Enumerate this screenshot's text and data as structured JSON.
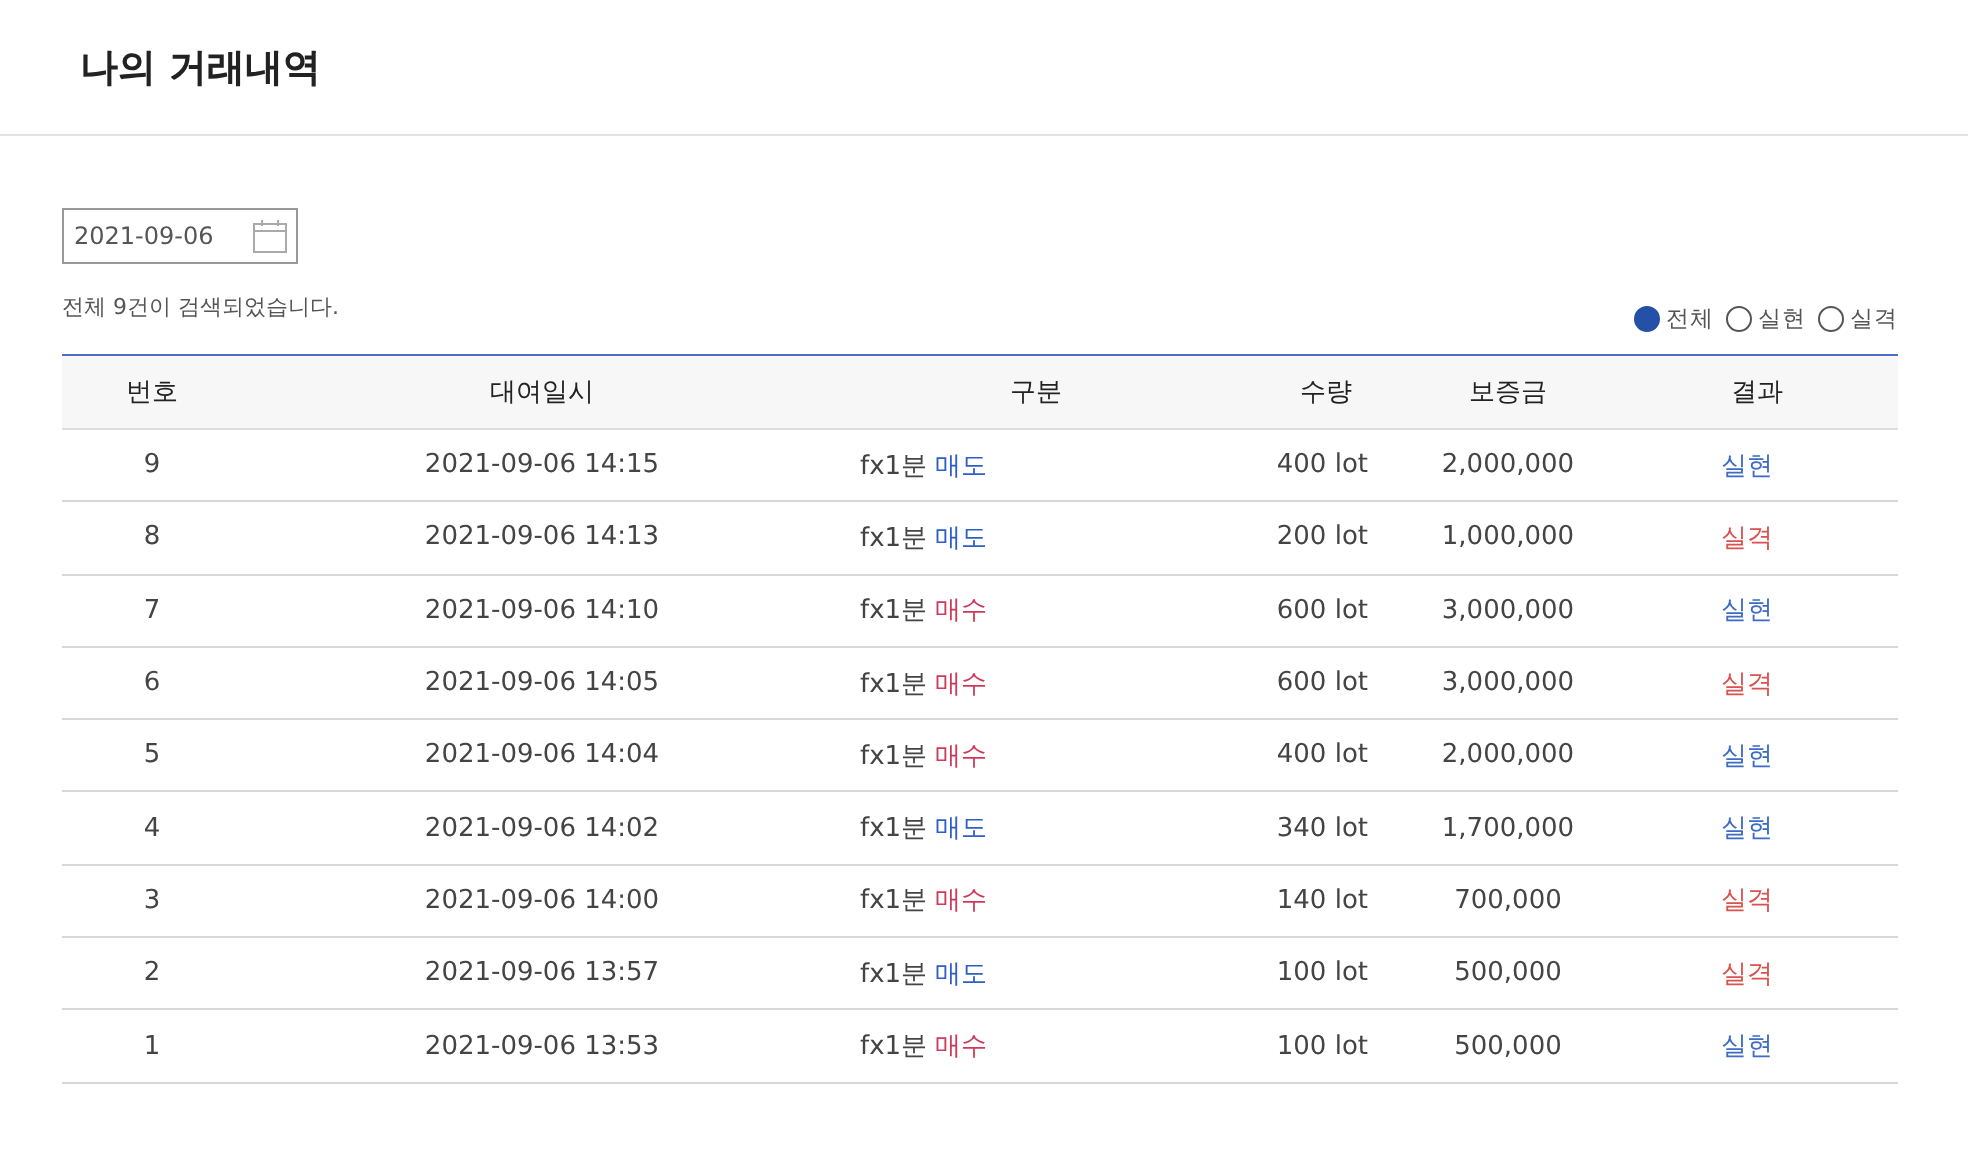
{
  "page": {
    "title": "나의 거래내역"
  },
  "date_field": {
    "value": "2021-09-06"
  },
  "result_count": "전체 9건이 검색되었습니다.",
  "filters": [
    {
      "label": "전체",
      "selected": true
    },
    {
      "label": "실현",
      "selected": false
    },
    {
      "label": "실격",
      "selected": false
    }
  ],
  "table": {
    "columns": [
      "번호",
      "대여일시",
      "구분",
      "수량",
      "보증금",
      "결과"
    ],
    "rows": [
      {
        "no": "9",
        "datetime": "2021-09-06 14:15",
        "product": "fx1분",
        "side": {
          "text": "매도",
          "kind": "sell"
        },
        "quantity": "400 lot",
        "deposit": "2,000,000",
        "result": {
          "text": "실현",
          "kind": "win"
        }
      },
      {
        "no": "8",
        "datetime": "2021-09-06 14:13",
        "product": "fx1분",
        "side": {
          "text": "매도",
          "kind": "sell"
        },
        "quantity": "200 lot",
        "deposit": "1,000,000",
        "result": {
          "text": "실격",
          "kind": "loss"
        }
      },
      {
        "no": "7",
        "datetime": "2021-09-06 14:10",
        "product": "fx1분",
        "side": {
          "text": "매수",
          "kind": "buy"
        },
        "quantity": "600 lot",
        "deposit": "3,000,000",
        "result": {
          "text": "실현",
          "kind": "win"
        }
      },
      {
        "no": "6",
        "datetime": "2021-09-06 14:05",
        "product": "fx1분",
        "side": {
          "text": "매수",
          "kind": "buy"
        },
        "quantity": "600 lot",
        "deposit": "3,000,000",
        "result": {
          "text": "실격",
          "kind": "loss"
        }
      },
      {
        "no": "5",
        "datetime": "2021-09-06 14:04",
        "product": "fx1분",
        "side": {
          "text": "매수",
          "kind": "buy"
        },
        "quantity": "400 lot",
        "deposit": "2,000,000",
        "result": {
          "text": "실현",
          "kind": "win"
        }
      },
      {
        "no": "4",
        "datetime": "2021-09-06 14:02",
        "product": "fx1분",
        "side": {
          "text": "매도",
          "kind": "sell"
        },
        "quantity": "340 lot",
        "deposit": "1,700,000",
        "result": {
          "text": "실현",
          "kind": "win"
        }
      },
      {
        "no": "3",
        "datetime": "2021-09-06 14:00",
        "product": "fx1분",
        "side": {
          "text": "매수",
          "kind": "buy"
        },
        "quantity": "140 lot",
        "deposit": "700,000",
        "result": {
          "text": "실격",
          "kind": "loss"
        }
      },
      {
        "no": "2",
        "datetime": "2021-09-06 13:57",
        "product": "fx1분",
        "side": {
          "text": "매도",
          "kind": "sell"
        },
        "quantity": "100 lot",
        "deposit": "500,000",
        "result": {
          "text": "실격",
          "kind": "loss"
        }
      },
      {
        "no": "1",
        "datetime": "2021-09-06 13:53",
        "product": "fx1분",
        "side": {
          "text": "매수",
          "kind": "buy"
        },
        "quantity": "100 lot",
        "deposit": "500,000",
        "result": {
          "text": "실현",
          "kind": "win"
        }
      }
    ]
  }
}
